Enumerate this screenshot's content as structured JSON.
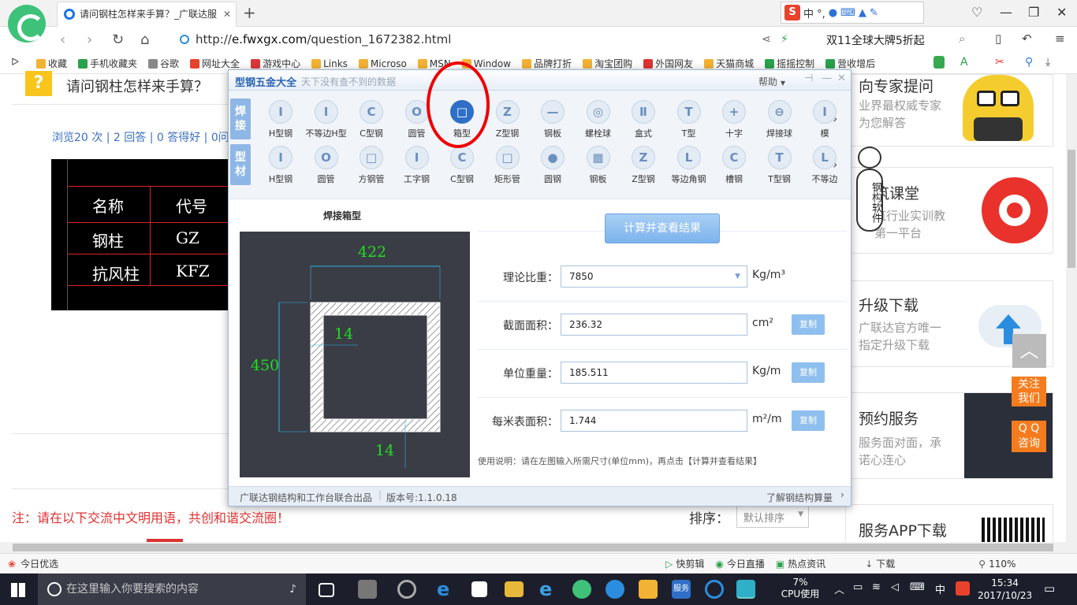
{
  "browser": {
    "tab_title": "请问钢柱怎样来手算？_广联达服",
    "url_prefix": "http://",
    "url_host": "e.fwxgx.com",
    "url_path": "/question_1672382.html",
    "promo": "双11全球大牌5折起",
    "sogou_text": "中 °,",
    "bookmarks": [
      "收藏",
      "手机收藏夹",
      "谷歌",
      "网址大全",
      "游戏中心",
      "Links",
      "Microso",
      "MSN",
      "Window",
      "品牌打折",
      "淘宝团购",
      "外国网友",
      "天猫商城",
      "摇摇控制",
      "营收增后"
    ]
  },
  "page": {
    "question_title": "请问钢柱怎样来手算？",
    "stats": "浏览20 次 | 2 回答 | 0 答得好 | 0问",
    "cad_rows": [
      [
        "名称",
        "代号"
      ],
      [
        "钢柱",
        "GZ"
      ],
      [
        "抗风柱",
        "KFZ"
      ]
    ],
    "note": "注：请在以下交流中文明用语，共创和谐交流圈！",
    "sort_label": "排序：",
    "sort_value": "默认排序"
  },
  "sidebar": {
    "card1": {
      "title": "向专家提问",
      "desc1": "业界最权威专家",
      "desc2": "为您解答"
    },
    "card2": {
      "title": "筑课堂",
      "desc1": "筑行业实训教",
      "desc2": "第一平台"
    },
    "card3": {
      "title": "升级下载",
      "desc1": "广联达官方唯一",
      "desc2": "指定升级下载"
    },
    "card4": {
      "title": "预约服务",
      "desc1": "服务面对面，承",
      "desc2": "诺心连心"
    },
    "card5": {
      "title": "服务APP下载"
    },
    "follow": [
      "关注",
      "我们"
    ],
    "qq": [
      "Q Q",
      "咨询"
    ],
    "mascot_text": "钢构软件"
  },
  "app": {
    "title": "型钢五金大全",
    "slogan": "天下没有查不到的数据",
    "help": "帮助",
    "row1_label": "焊接",
    "row2_label": "型材",
    "row1": [
      {
        "label": "H型钢",
        "glyph": "I"
      },
      {
        "label": "不等边H型",
        "glyph": "I"
      },
      {
        "label": "C型钢",
        "glyph": "C"
      },
      {
        "label": "圆管",
        "glyph": "O"
      },
      {
        "label": "箱型",
        "glyph": "□",
        "selected": true
      },
      {
        "label": "Z型钢",
        "glyph": "Z"
      },
      {
        "label": "钢板",
        "glyph": "—"
      },
      {
        "label": "螺栓球",
        "glyph": "◎"
      },
      {
        "label": "盒式",
        "glyph": "Ⅱ"
      },
      {
        "label": "T型",
        "glyph": "T"
      },
      {
        "label": "十字",
        "glyph": "+"
      },
      {
        "label": "焊接球",
        "glyph": "⊖"
      },
      {
        "label": "模",
        "glyph": "I"
      }
    ],
    "row2": [
      {
        "label": "H型钢",
        "glyph": "I"
      },
      {
        "label": "圆管",
        "glyph": "O"
      },
      {
        "label": "方钢管",
        "glyph": "□"
      },
      {
        "label": "工字钢",
        "glyph": "I"
      },
      {
        "label": "C型钢",
        "glyph": "C"
      },
      {
        "label": "矩形管",
        "glyph": "□"
      },
      {
        "label": "圆钢",
        "glyph": "●"
      },
      {
        "label": "钢板",
        "glyph": "▦"
      },
      {
        "label": "Z型钢",
        "glyph": "Z"
      },
      {
        "label": "等边角钢",
        "glyph": "L"
      },
      {
        "label": "槽钢",
        "glyph": "C"
      },
      {
        "label": "T型钢",
        "glyph": "T"
      },
      {
        "label": "不等边",
        "glyph": "L"
      }
    ],
    "panel_title": "焊接箱型",
    "dims": {
      "width": "422",
      "height": "450",
      "web": "14",
      "flange": "14"
    },
    "calc_button": "计算并查看结果",
    "fields": [
      {
        "label": "理论比重：",
        "value": "7850",
        "unit": "Kg/m³",
        "dropdown": true
      },
      {
        "label": "截面面积：",
        "value": "236.32",
        "unit": "cm²",
        "copy": "复制"
      },
      {
        "label": "单位重量：",
        "value": "185.511",
        "unit": "Kg/m",
        "copy": "复制"
      },
      {
        "label": "每米表面积：",
        "value": "1.744",
        "unit": "m²/m",
        "copy": "复制"
      }
    ],
    "usage": "使用说明：请在左图输入所需尺寸(单位mm)，再点击【计算并查看结果】",
    "footer_left": "广联达钢结构和工作台联合出品",
    "version": "版本号:1.1.0.18",
    "footer_right": "了解钢结构算量"
  },
  "statusbar": {
    "left": "今日优选",
    "items": [
      "快剪辑",
      "今日直播",
      "热点资讯",
      "下载"
    ],
    "zoom": "110%"
  },
  "taskbar": {
    "search_placeholder": "在这里输入你要搜索的内容",
    "cpu_pct": "7%",
    "cpu_label": "CPU使用",
    "ime": "中",
    "time": "15:34",
    "date": "2017/10/23"
  }
}
